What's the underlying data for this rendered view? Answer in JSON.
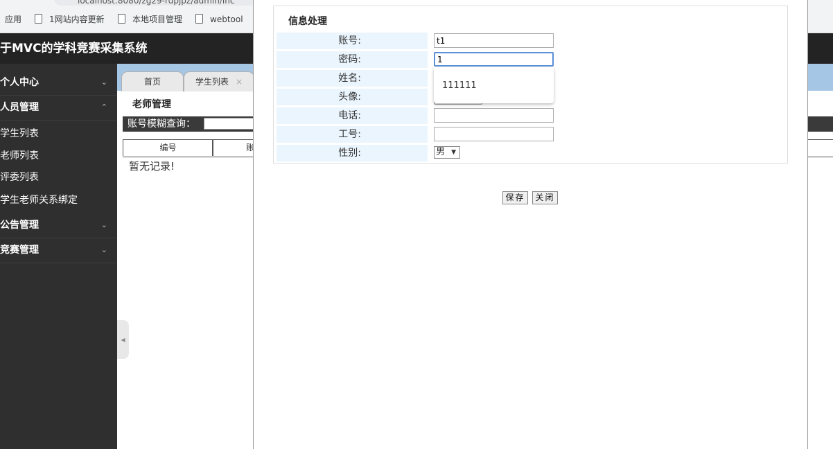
{
  "browser": {
    "url": "localhost:8080/zg29-rdpjpz/admin/inc",
    "bookmarks": [
      "应用",
      "1网站内容更新",
      "本地项目管理",
      "webtool"
    ]
  },
  "app": {
    "title": "于MVC的学科竞赛采集系统"
  },
  "sidebar": {
    "groups": [
      {
        "label": "个人中心",
        "chevron": "⌄"
      },
      {
        "label": "人员管理",
        "chevron": "⌃"
      },
      {
        "label": "公告管理",
        "chevron": "⌄"
      },
      {
        "label": "竞赛管理",
        "chevron": "⌄"
      }
    ],
    "items": [
      "学生列表",
      "老师列表",
      "评委列表",
      "学生老师关系绑定"
    ],
    "collapse_icon": "◂"
  },
  "tabs": [
    {
      "label": "首页"
    },
    {
      "label": "学生列表",
      "close": "×"
    }
  ],
  "content": {
    "section_title": "老师管理",
    "search_label": "账号模糊查询：",
    "columns": [
      "编号",
      "账"
    ],
    "empty_text": "暂无记录!"
  },
  "form": {
    "title": "信息处理",
    "fields": [
      {
        "label": "账号:",
        "value": "t1"
      },
      {
        "label": "密码:",
        "value": "1"
      },
      {
        "label": "姓名:",
        "value": ""
      },
      {
        "label": "头像:",
        "value": ""
      },
      {
        "label": "电话:",
        "value": ""
      },
      {
        "label": "工号:",
        "value": ""
      },
      {
        "label": "性别:",
        "value": "男"
      }
    ],
    "autocomplete": [
      "111111"
    ],
    "select_arrow": "▼",
    "save_label": "保存",
    "close_label": "关闭"
  }
}
